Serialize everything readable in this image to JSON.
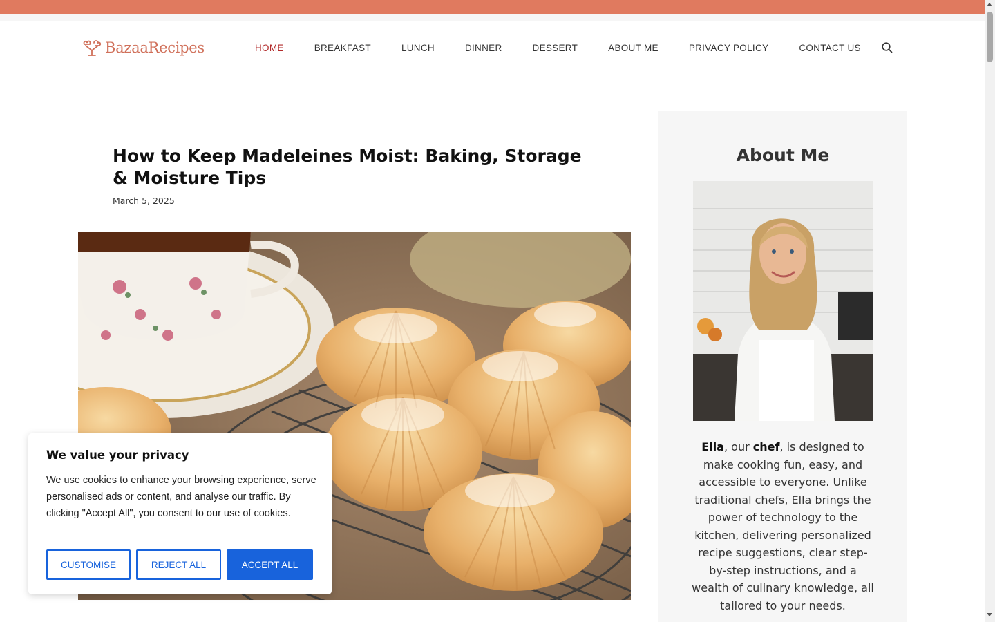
{
  "site": {
    "logo_text": "BazaaRecipes",
    "brand_color": "#e07a5f"
  },
  "nav": {
    "items": [
      {
        "label": "HOME",
        "active": true
      },
      {
        "label": "BREAKFAST"
      },
      {
        "label": "LUNCH"
      },
      {
        "label": "DINNER"
      },
      {
        "label": "DESSERT"
      },
      {
        "label": "ABOUT ME"
      },
      {
        "label": "PRIVACY POLICY"
      },
      {
        "label": "CONTACT US"
      }
    ],
    "search_icon": "search-icon"
  },
  "article": {
    "title": "How to Keep Madeleines Moist: Baking, Storage & Moisture Tips",
    "date": "March 5, 2025",
    "hero_description": "madeleines-on-cooling-rack"
  },
  "sidebar": {
    "title": "About Me",
    "bio_name": "Ella",
    "bio_part1": ", our ",
    "bio_bold": "chef",
    "bio_part2": ", is designed to make cooking fun, easy, and accessible to everyone. Unlike traditional chefs, Ella brings the power of technology to the kitchen, delivering personalized recipe suggestions, clear step-by-step instructions, and a wealth of culinary knowledge, all tailored to your needs."
  },
  "cookie": {
    "title": "We value your privacy",
    "text": "We use cookies to enhance your browsing experience, serve personalised ads or content, and analyse our traffic. By clicking \"Accept All\", you consent to our use of cookies.",
    "customise": "CUSTOMISE",
    "reject": "REJECT ALL",
    "accept": "ACCEPT ALL",
    "accent": "#1863dc"
  }
}
